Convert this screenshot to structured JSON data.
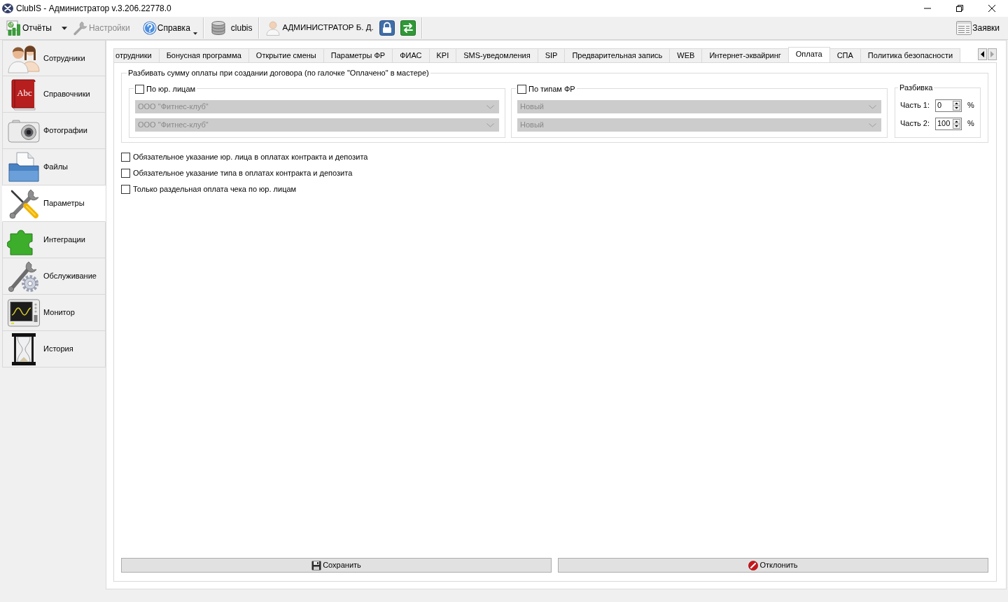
{
  "window": {
    "title": "ClubIS - Администратор v.3.206.22778.0"
  },
  "toolbar": {
    "items": [
      {
        "kind": "reports",
        "label": "Отчёты",
        "disabled": false
      },
      {
        "kind": "settings",
        "label": "Настройки",
        "disabled": true
      },
      {
        "kind": "help",
        "label": "Справка",
        "disabled": false
      },
      {
        "kind": "database",
        "label": "clubis",
        "disabled": false
      },
      {
        "kind": "user",
        "label": "АДМИНИСТРАТОР Б. Д.",
        "disabled": false
      },
      {
        "kind": "lock",
        "disabled": false
      },
      {
        "kind": "switch",
        "disabled": false
      }
    ],
    "requests": {
      "label": "Заявки"
    }
  },
  "sidebar": {
    "items": [
      {
        "label": "Сотрудники",
        "selected": false
      },
      {
        "label": "Справочники",
        "selected": false,
        "icon_text": "Abc"
      },
      {
        "label": "Фотографии",
        "selected": false
      },
      {
        "label": "Файлы",
        "selected": false
      },
      {
        "label": "Параметры",
        "selected": true
      },
      {
        "label": "Интеграции",
        "selected": false
      },
      {
        "label": "Обслуживание",
        "selected": false
      },
      {
        "label": "Монитор",
        "selected": false
      },
      {
        "label": "История",
        "selected": false
      }
    ]
  },
  "tabs": [
    {
      "label": "отрудники",
      "selected": false
    },
    {
      "label": "Бонусная программа",
      "selected": false
    },
    {
      "label": "Открытие смены",
      "selected": false
    },
    {
      "label": "Параметры ФР",
      "selected": false
    },
    {
      "label": "ФИАС",
      "selected": false
    },
    {
      "label": "KPI",
      "selected": false
    },
    {
      "label": "SMS-уведомления",
      "selected": false
    },
    {
      "label": "SIP",
      "selected": false
    },
    {
      "label": "Предварительная запись",
      "selected": false
    },
    {
      "label": "WEB",
      "selected": false
    },
    {
      "label": "Интернет-эквайринг",
      "selected": false
    },
    {
      "label": "Оплата",
      "selected": true
    },
    {
      "label": "СПА",
      "selected": false
    },
    {
      "label": "Политика безопасности",
      "selected": false
    }
  ],
  "tab_scroll_buttons": [
    {
      "kind": "left",
      "disabled": false
    },
    {
      "kind": "right",
      "disabled": true
    }
  ],
  "split_group": {
    "title": "Разбивать сумму оплаты при создании договора (по галочке \"Оплачено\" в мастере)",
    "by_legal_entity": {
      "label": "По юр. лицам",
      "checked": false,
      "selects": [
        "ООО \"Фитнес-клуб\"",
        "ООО \"Фитнес-клуб\""
      ]
    },
    "by_fr_type": {
      "label": "По типам ФР",
      "checked": false,
      "selects": [
        "Новый",
        "Новый"
      ]
    },
    "split": {
      "title": "Разбивка",
      "parts": [
        {
          "label": "Часть 1:",
          "value": "0",
          "unit": "%"
        },
        {
          "label": "Часть 2:",
          "value": "100",
          "unit": "%"
        }
      ]
    }
  },
  "options": [
    {
      "label": "Обязательное указание юр. лица в оплатах контракта и депозита",
      "checked": false
    },
    {
      "label": "Обязательное указание типа в оплатах контракта и депозита",
      "checked": false
    },
    {
      "label": "Только раздельная оплата чека по юр. лицам",
      "checked": false
    }
  ],
  "buttons": [
    {
      "kind": "save",
      "label": "Сохранить"
    },
    {
      "kind": "cancel",
      "label": "Отклонить"
    }
  ]
}
